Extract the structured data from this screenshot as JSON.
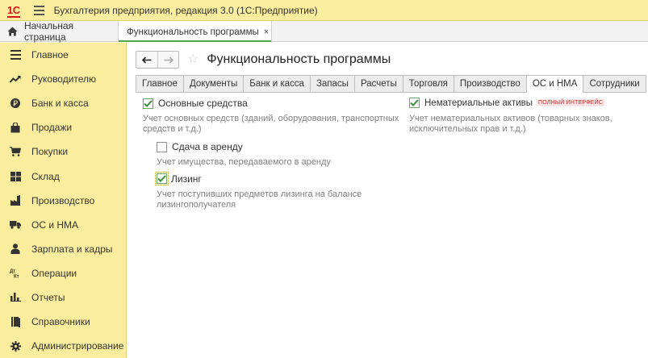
{
  "titlebar": {
    "logo": "1С",
    "title": "Бухгалтерия предприятия, редакция 3.0  (1С:Предприятие)"
  },
  "tabbar": {
    "home_label": "Начальная страница",
    "open_tab_label": "Функциональность программы",
    "close_glyph": "×"
  },
  "sidebar": {
    "items": [
      {
        "label": "Главное",
        "icon": "menu-lines-icon"
      },
      {
        "label": "Руководителю",
        "icon": "trend-chart-icon"
      },
      {
        "label": "Банк и касса",
        "icon": "ruble-coin-icon"
      },
      {
        "label": "Продажи",
        "icon": "shopping-bag-icon"
      },
      {
        "label": "Покупки",
        "icon": "shopping-cart-icon"
      },
      {
        "label": "Склад",
        "icon": "warehouse-grid-icon"
      },
      {
        "label": "Производство",
        "icon": "factory-icon"
      },
      {
        "label": "ОС и НМА",
        "icon": "truck-icon"
      },
      {
        "label": "Зарплата и кадры",
        "icon": "person-icon"
      },
      {
        "label": "Операции",
        "icon": "debit-credit-icon"
      },
      {
        "label": "Отчеты",
        "icon": "bar-chart-icon"
      },
      {
        "label": "Справочники",
        "icon": "book-icon"
      },
      {
        "label": "Администрирование",
        "icon": "gear-icon"
      }
    ]
  },
  "content": {
    "title": "Функциональность программы",
    "tabs": [
      {
        "label": "Главное",
        "active": false
      },
      {
        "label": "Документы",
        "active": false
      },
      {
        "label": "Банк и касса",
        "active": false
      },
      {
        "label": "Запасы",
        "active": false
      },
      {
        "label": "Расчеты",
        "active": false
      },
      {
        "label": "Торговля",
        "active": false
      },
      {
        "label": "Производство",
        "active": false
      },
      {
        "label": "ОС и НМА",
        "active": true
      },
      {
        "label": "Сотрудники",
        "active": false
      }
    ],
    "options": {
      "fixed_assets": {
        "label": "Основные средства",
        "checked": true,
        "description_1": "Учет основных средств (зданий, оборудования, транспортных",
        "description_2": "средств и т.д.)"
      },
      "intangible": {
        "label": "Нематериальные активы",
        "checked": true,
        "badge": "ПОЛНЫЙ ИНТЕРФЕЙС",
        "description_1": "Учет нематериальных активов (товарных знаков,",
        "description_2": "исключительных прав и т.д.)"
      },
      "rental": {
        "label": "Сдача в аренду",
        "checked": false,
        "description": "Учет имущества, передаваемого в аренду"
      },
      "leasing": {
        "label": "Лизинг",
        "checked": true,
        "description_1": "Учет поступивших предметов лизинга на балансе",
        "description_2": "лизингополучателя"
      }
    }
  },
  "colors": {
    "sidebar_bg": "#fbed9e",
    "accent_green": "#4ba94b",
    "logo_red": "#d4161c"
  }
}
